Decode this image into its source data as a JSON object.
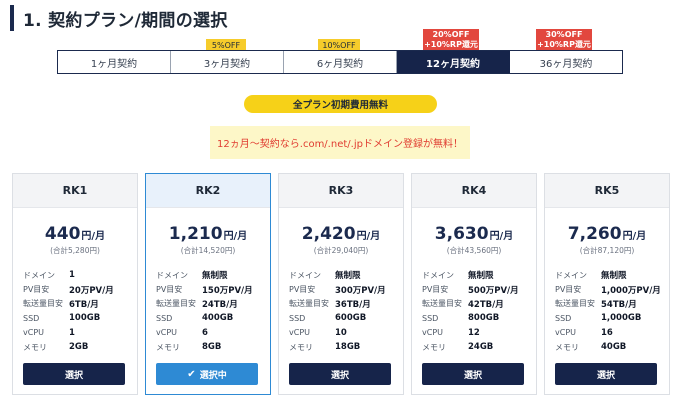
{
  "heading": {
    "title": "1. 契約プラン/期間の選択"
  },
  "tabs": [
    {
      "label": "1ヶ月契約"
    },
    {
      "label": "3ヶ月契約",
      "badge": "5%OFF"
    },
    {
      "label": "6ヶ月契約",
      "badge": "10%OFF"
    },
    {
      "label": "12ヶ月契約",
      "badge_line1": "20%OFF",
      "badge_line2": "+10%RP還元",
      "active": true
    },
    {
      "label": "36ヶ月契約",
      "badge_line1": "30%OFF",
      "badge_line2": "+10%RP還元"
    }
  ],
  "pill": {
    "label": "全プラン初期費用無料"
  },
  "notice": {
    "text": "12ヵ月〜契約なら.com/.net/.jpドメイン登録が無料！"
  },
  "spec_labels": {
    "domain": "ドメイン",
    "pv": "PV目安",
    "transfer": "転送量目安",
    "ssd": "SSD",
    "vcpu": "vCPU",
    "memory": "メモリ"
  },
  "plans": [
    {
      "name": "RK1",
      "price": "440",
      "unit": "円/月",
      "total": "(合計5,280円)",
      "domain": "1",
      "pv": "20万PV/月",
      "transfer": "6TB/月",
      "ssd": "100GB",
      "vcpu": "1",
      "memory": "2GB",
      "button": "選択"
    },
    {
      "name": "RK2",
      "price": "1,210",
      "unit": "円/月",
      "total": "(合計14,520円)",
      "domain": "無制限",
      "pv": "150万PV/月",
      "transfer": "24TB/月",
      "ssd": "400GB",
      "vcpu": "6",
      "memory": "8GB",
      "button": "選択中",
      "selected": true
    },
    {
      "name": "RK3",
      "price": "2,420",
      "unit": "円/月",
      "total": "(合計29,040円)",
      "domain": "無制限",
      "pv": "300万PV/月",
      "transfer": "36TB/月",
      "ssd": "600GB",
      "vcpu": "10",
      "memory": "18GB",
      "button": "選択"
    },
    {
      "name": "RK4",
      "price": "3,630",
      "unit": "円/月",
      "total": "(合計43,560円)",
      "domain": "無制限",
      "pv": "500万PV/月",
      "transfer": "42TB/月",
      "ssd": "800GB",
      "vcpu": "12",
      "memory": "24GB",
      "button": "選択"
    },
    {
      "name": "RK5",
      "price": "7,260",
      "unit": "円/月",
      "total": "(合計87,120円)",
      "domain": "無制限",
      "pv": "1,000万PV/月",
      "transfer": "54TB/月",
      "ssd": "1,000GB",
      "vcpu": "16",
      "memory": "40GB",
      "button": "選択"
    }
  ],
  "colors": {
    "navy": "#16244a",
    "accent_blue": "#2e8ad4",
    "badge_yellow": "#f6cc2b",
    "badge_red": "#e2473e",
    "notice_red": "#e03c31"
  },
  "icons": {
    "selected_check": "check-icon"
  }
}
